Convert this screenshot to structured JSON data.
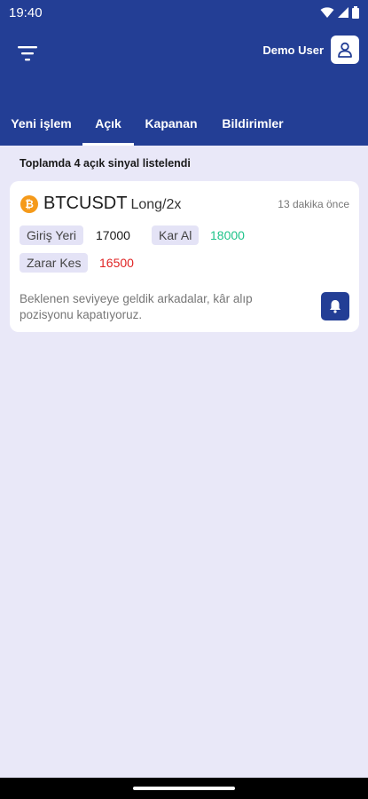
{
  "status": {
    "time": "19:40"
  },
  "header": {
    "user_name": "Demo User"
  },
  "tabs": [
    {
      "label": "Yeni işlem",
      "active": false
    },
    {
      "label": "Açık",
      "active": true
    },
    {
      "label": "Kapanan",
      "active": false
    },
    {
      "label": "Bildirimler",
      "active": false
    }
  ],
  "summary": "Toplamda 4 açık sinyal listelendi",
  "signal": {
    "coin_symbol": "₿",
    "pair": "BTCUSDT",
    "position": "Long/2x",
    "time_ago": "13 dakika önce",
    "entry_label": "Giriş Yeri",
    "entry_value": "17000",
    "take_profit_label": "Kar Al",
    "take_profit_value": "18000",
    "stop_loss_label": "Zarar Kes",
    "stop_loss_value": "16500",
    "note": "Beklenen seviyeye geldik arkadalar, kâr alıp pozisyonu kapatıyoruz."
  },
  "colors": {
    "primary": "#233e95",
    "background": "#e9e8f8",
    "profit": "#1ec38a",
    "loss": "#e02424",
    "coin": "#f59a1a"
  }
}
